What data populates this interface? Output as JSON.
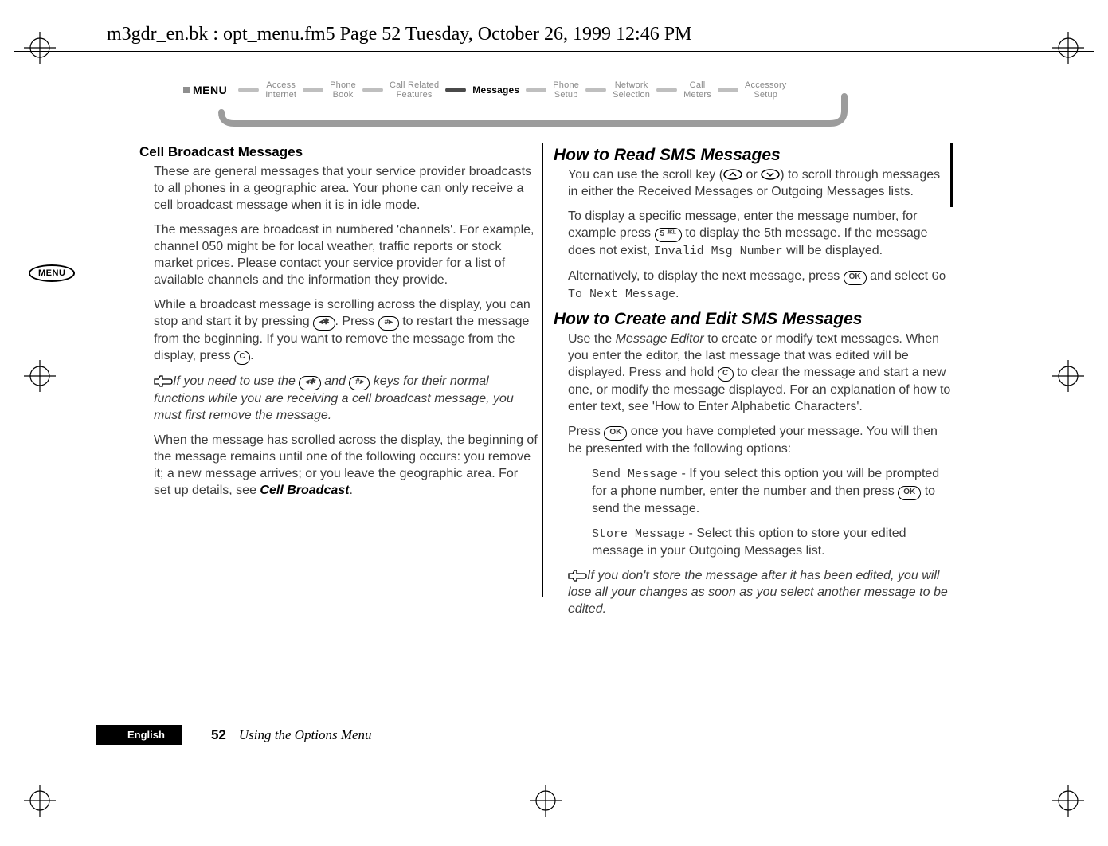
{
  "header_line": "m3gdr_en.bk : opt_menu.fm5  Page 52  Tuesday, October 26, 1999  12:46 PM",
  "menu_bar": {
    "label": "MENU",
    "items": [
      {
        "l1": "Access",
        "l2": "Internet",
        "active": false
      },
      {
        "l1": "Phone",
        "l2": "Book",
        "active": false
      },
      {
        "l1": "Call Related",
        "l2": "Features",
        "active": false
      },
      {
        "l1": "Messages",
        "l2": "",
        "active": true
      },
      {
        "l1": "Phone",
        "l2": "Setup",
        "active": false
      },
      {
        "l1": "Network",
        "l2": "Selection",
        "active": false
      },
      {
        "l1": "Call",
        "l2": "Meters",
        "active": false
      },
      {
        "l1": "Accessory",
        "l2": "Setup",
        "active": false
      }
    ]
  },
  "sidebar_pill": "MENU",
  "left": {
    "h_cell": "Cell Broadcast Messages",
    "p1": "These are general messages that your service provider broadcasts to all phones in a geographic area. Your phone can only receive a cell broadcast message when it is in idle mode.",
    "p2": "The messages are broadcast in numbered 'channels'. For example, channel 050 might be for local weather, traffic reports or stock market prices. Please contact your service provider for a list of available channels and the information they provide.",
    "p3a": "While a broadcast message is scrolling across the display, you can stop and start it by pressing ",
    "p3b": ". Press ",
    "p3c": " to restart the message from the beginning. If you want to remove the message from the display, press ",
    "p3d": ".",
    "note1a": "If you need to use the ",
    "note1b": " and ",
    "note1c": " keys for their normal functions while you are receiving a cell broadcast message, you must first remove the message.",
    "p4a": "When the message has scrolled across the display, the beginning of the message remains until one of the following occurs: you remove it; a new message arrives; or you leave the geographic area. For set up details, see ",
    "p4b": "Cell Broadcast",
    "p4c": "."
  },
  "right": {
    "h_read": "How to Read SMS Messages",
    "p1a": "You can use the scroll key (",
    "p1b": " or ",
    "p1c": ") to scroll through messages in either the Received Messages or Outgoing Messages lists.",
    "p2a": "To display a specific message, enter the message number, for example press ",
    "p2b": " to display the 5th message. If the message does not exist, ",
    "p2_lcd": "Invalid Msg Number",
    "p2c": " will be displayed.",
    "p3a": "Alternatively, to display the next message, press ",
    "p3b": " and select ",
    "p3_lcd": "Go To Next Message",
    "p3c": ".",
    "h_create": "How to Create and Edit SMS Messages",
    "p4a": "Use the ",
    "p4_em": "Message Editor",
    "p4b": " to create or modify text messages. When you enter the editor, the last message that was edited will be displayed. Press and hold ",
    "p4c": " to clear the message and start a new one, or modify the message displayed. For an explanation of how to enter text, see 'How to Enter Alphabetic Characters'.",
    "p5a": "Press ",
    "p5b": " once you have completed your message. You will then be presented with the following options:",
    "opt1_lcd": "Send Message",
    "opt1a": " - If you select this option you will be prompted for a phone number, enter the number and then press ",
    "opt1b": " to send the message.",
    "opt2_lcd": "Store Message",
    "opt2a": " - Select this option to store your edited message in your Outgoing Messages list.",
    "note2": "If you don't store the message after it has been edited, you will lose all your changes as soon as you select another message to be edited."
  },
  "keys": {
    "star": "✱",
    "hash": "#▸",
    "star_l": "◂✱",
    "c": "C",
    "ok": "OK",
    "five": "5 ᴶᴷᴸ"
  },
  "footer": {
    "lang": "English",
    "page": "52",
    "section": "Using the Options Menu"
  }
}
